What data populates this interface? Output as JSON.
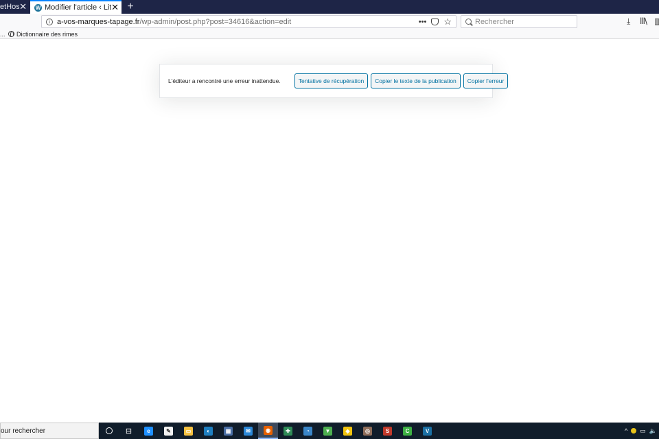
{
  "browser": {
    "tabs": [
      {
        "title": "etHoster",
        "state": "inactive"
      },
      {
        "title": "Modifier l'article ‹ Littérature, n",
        "state": "active"
      }
    ],
    "tab_close_glyph": "✕",
    "new_tab_glyph": "+",
    "url": {
      "domain": "a-vos-marques-tapage.fr",
      "path": "/wp-admin/post.php?post=34616&action=edit"
    },
    "page_actions_glyph": "•••",
    "search": {
      "placeholder": "Rechercher"
    },
    "bookmarks": {
      "overflow": "...",
      "items": [
        {
          "label": "Dictionnaire des rimes",
          "icon": "globe-icon"
        }
      ]
    }
  },
  "editor_error": {
    "message": "L'éditeur a rencontré une erreur inattendue.",
    "buttons": {
      "recover": "Tentative de récupération",
      "copy_post": "Copier le texte de la publication",
      "copy_error": "Copier l'erreur"
    }
  },
  "taskbar": {
    "search_text": "our rechercher",
    "apps": [
      {
        "name": "cortana-icon"
      },
      {
        "name": "task-view-icon"
      },
      {
        "name": "edge-icon",
        "color": "#1e90ff",
        "letter": "e"
      },
      {
        "name": "notepad-icon",
        "color": "#f2f2f2",
        "letter": "✎"
      },
      {
        "name": "file-explorer-icon",
        "color": "#f5c242",
        "letter": "▭"
      },
      {
        "name": "app-icon-1",
        "color": "#1e7fc1",
        "letter": "◐"
      },
      {
        "name": "app-icon-2",
        "color": "#4a6fa5",
        "letter": "▦"
      },
      {
        "name": "mail-icon",
        "color": "#2b88d8",
        "letter": "✉"
      },
      {
        "name": "firefox-icon",
        "color": "#e66000",
        "letter": "◉",
        "active": true
      },
      {
        "name": "app-icon-3",
        "color": "#2e8b57",
        "letter": "✚"
      },
      {
        "name": "app-icon-4",
        "color": "#3a86c8",
        "letter": "◔"
      },
      {
        "name": "shield-app-icon",
        "color": "#4caf50",
        "letter": "▼"
      },
      {
        "name": "app-icon-5",
        "color": "#f1c40f",
        "letter": "◆"
      },
      {
        "name": "app-icon-6",
        "color": "#8e6d5a",
        "letter": "◎"
      },
      {
        "name": "app-icon-7",
        "color": "#c0392b",
        "letter": "S"
      },
      {
        "name": "camtasia-icon",
        "color": "#3cb043",
        "letter": "C"
      },
      {
        "name": "app-icon-8",
        "color": "#1a6fa3",
        "letter": "V"
      }
    ],
    "tray": {
      "chevron": "^",
      "icons": [
        "▭",
        "🔈"
      ]
    }
  },
  "colors": {
    "tab_strip": "#1e2547",
    "wp_button": "#0071a1",
    "taskbar": "#101d2b"
  }
}
